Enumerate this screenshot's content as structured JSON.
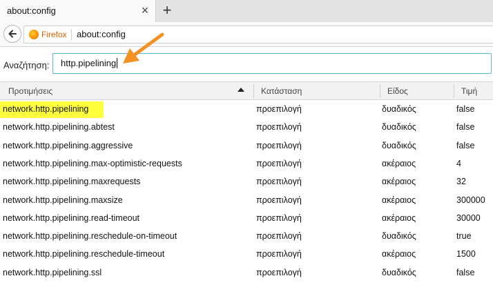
{
  "tab": {
    "title": "about:config"
  },
  "nav": {
    "identity_label": "Firefox",
    "url": "about:config"
  },
  "search": {
    "label": "Αναζήτηση:",
    "value": "http.pipelining"
  },
  "table": {
    "headers": {
      "name": "Προτιμήσεις",
      "status": "Κατάσταση",
      "type": "Είδος",
      "value": "Τιμή"
    },
    "rows": [
      {
        "name": "network.http.pipelining",
        "status": "προεπιλογή",
        "type": "δυαδικός",
        "value": "false"
      },
      {
        "name": "network.http.pipelining.abtest",
        "status": "προεπιλογή",
        "type": "δυαδικός",
        "value": "false"
      },
      {
        "name": "network.http.pipelining.aggressive",
        "status": "προεπιλογή",
        "type": "δυαδικός",
        "value": "false"
      },
      {
        "name": "network.http.pipelining.max-optimistic-requests",
        "status": "προεπιλογή",
        "type": "ακέραιος",
        "value": "4"
      },
      {
        "name": "network.http.pipelining.maxrequests",
        "status": "προεπιλογή",
        "type": "ακέραιος",
        "value": "32"
      },
      {
        "name": "network.http.pipelining.maxsize",
        "status": "προεπιλογή",
        "type": "ακέραιος",
        "value": "300000"
      },
      {
        "name": "network.http.pipelining.read-timeout",
        "status": "προεπιλογή",
        "type": "ακέραιος",
        "value": "30000"
      },
      {
        "name": "network.http.pipelining.reschedule-on-timeout",
        "status": "προεπιλογή",
        "type": "δυαδικός",
        "value": "true"
      },
      {
        "name": "network.http.pipelining.reschedule-timeout",
        "status": "προεπιλογή",
        "type": "ακέραιος",
        "value": "1500"
      },
      {
        "name": "network.http.pipelining.ssl",
        "status": "προεπιλογή",
        "type": "δυαδικός",
        "value": "false"
      }
    ]
  },
  "colors": {
    "highlight": "#ffff3d",
    "arrow": "#f39123",
    "search_focus_border": "#56b9d6",
    "firefox_label": "#e66000"
  },
  "icons": {
    "close": "close-icon",
    "new_tab": "plus-icon",
    "back": "back-arrow-icon",
    "identity": "firefox-icon",
    "sort": "sort-ascending-icon",
    "annotation": "arrow-annotation"
  }
}
